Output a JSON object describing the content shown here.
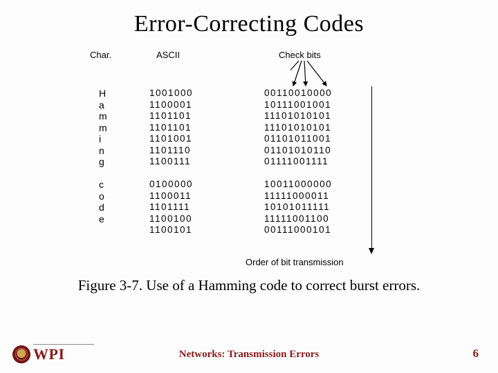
{
  "title": "Error-Correcting Codes",
  "headers": {
    "char": "Char.",
    "ascii": "ASCII",
    "check": "Check bits"
  },
  "rows1": [
    {
      "c": "H",
      "a": "1001000",
      "b": "00110010000"
    },
    {
      "c": "a",
      "a": "1100001",
      "b": "10111001001"
    },
    {
      "c": "m",
      "a": "1101101",
      "b": "11101010101"
    },
    {
      "c": "m",
      "a": "1101101",
      "b": "11101010101"
    },
    {
      "c": "i",
      "a": "1101001",
      "b": "01101011001"
    },
    {
      "c": "n",
      "a": "1101110",
      "b": "01101010110"
    },
    {
      "c": "g",
      "a": "1100111",
      "b": "01111001111"
    }
  ],
  "rows2": [
    {
      "c": "",
      "a": "0100000",
      "b": "10011000000"
    },
    {
      "c": "c",
      "a": "1100011",
      "b": "11111000011"
    },
    {
      "c": "o",
      "a": "1101111",
      "b": "10101011111"
    },
    {
      "c": "d",
      "a": "1100100",
      "b": "11111001100"
    },
    {
      "c": "e",
      "a": "1100101",
      "b": "00111000101"
    }
  ],
  "order_label": "Order of bit transmission",
  "caption": "Figure 3-7. Use of a Hamming code to correct burst errors.",
  "footer": "Networks: Transmission Errors",
  "page": "6",
  "logo_text": "WPI"
}
